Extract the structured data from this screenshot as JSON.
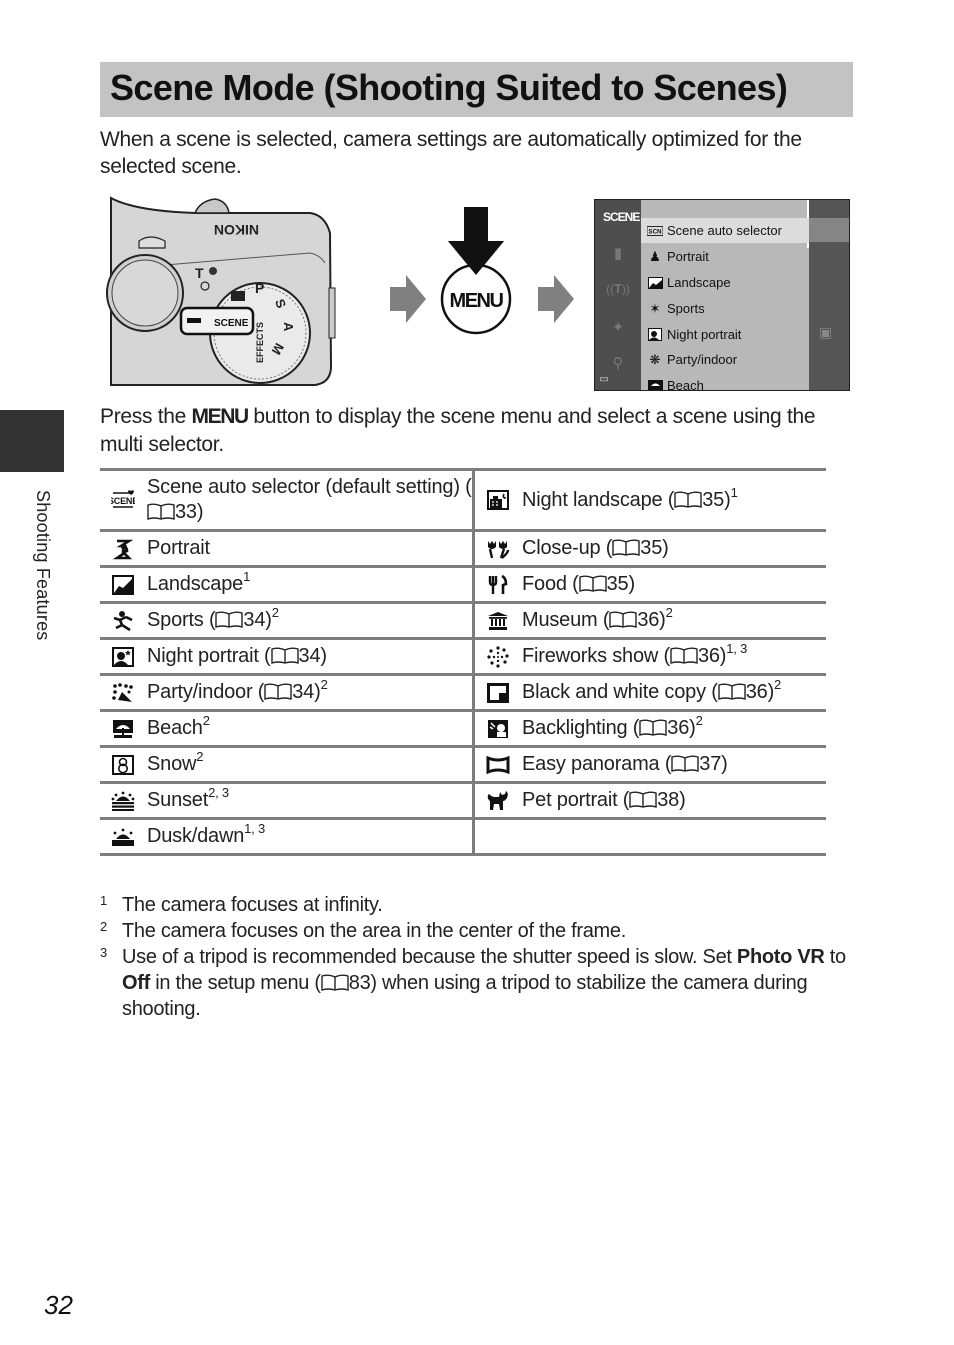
{
  "page": {
    "title": "Scene Mode (Shooting Suited to Scenes)",
    "intro": "When a scene is selected, camera settings are automatically optimized for the selected scene.",
    "side_label": "Shooting Features",
    "page_number": "32"
  },
  "illustration": {
    "camera": {
      "brand": "Nikon",
      "dial_labels": [
        "P",
        "S",
        "A",
        "M",
        "EFFECTS",
        "SCENE"
      ],
      "zoom_label": "T"
    },
    "menu_button_label": "MENU",
    "screen": {
      "left_icon": "SCENE",
      "items": [
        {
          "icon": "scene-auto-icon",
          "label": "Scene auto selector",
          "selected": true
        },
        {
          "icon": "portrait-icon",
          "label": "Portrait"
        },
        {
          "icon": "landscape-icon",
          "label": "Landscape"
        },
        {
          "icon": "sports-icon",
          "label": "Sports"
        },
        {
          "icon": "night-portrait-icon",
          "label": "Night portrait"
        },
        {
          "icon": "party-icon",
          "label": "Party/indoor"
        },
        {
          "icon": "beach-icon",
          "label": "Beach"
        }
      ]
    }
  },
  "instruction": {
    "before": "Press the ",
    "button": "MENU",
    "after": " button to display the scene menu and select a scene using the multi selector."
  },
  "scenes": {
    "left": [
      {
        "icon": "scene-auto-icon",
        "label": "Scene auto selector (default setting) (",
        "ref": "33",
        "close": ")",
        "sup": ""
      },
      {
        "icon": "portrait-icon",
        "label": "Portrait",
        "ref": "",
        "close": "",
        "sup": ""
      },
      {
        "icon": "landscape-icon",
        "label": "Landscape",
        "ref": "",
        "close": "",
        "sup": "1"
      },
      {
        "icon": "sports-icon",
        "label": "Sports (",
        "ref": "34",
        "close": ")",
        "sup": "2"
      },
      {
        "icon": "night-portrait-icon",
        "label": "Night portrait (",
        "ref": "34",
        "close": ")",
        "sup": ""
      },
      {
        "icon": "party-icon",
        "label": "Party/indoor (",
        "ref": "34",
        "close": ")",
        "sup": "2"
      },
      {
        "icon": "beach-icon",
        "label": "Beach",
        "ref": "",
        "close": "",
        "sup": "2"
      },
      {
        "icon": "snow-icon",
        "label": "Snow",
        "ref": "",
        "close": "",
        "sup": "2"
      },
      {
        "icon": "sunset-icon",
        "label": "Sunset",
        "ref": "",
        "close": "",
        "sup": "2, 3"
      },
      {
        "icon": "dusk-dawn-icon",
        "label": "Dusk/dawn",
        "ref": "",
        "close": "",
        "sup": "1, 3"
      }
    ],
    "right": [
      {
        "icon": "night-landscape-icon",
        "label": "Night landscape (",
        "ref": "35",
        "close": ")",
        "sup": "1"
      },
      {
        "icon": "close-up-icon",
        "label": "Close-up (",
        "ref": "35",
        "close": ")",
        "sup": ""
      },
      {
        "icon": "food-icon",
        "label": "Food (",
        "ref": "35",
        "close": ")",
        "sup": ""
      },
      {
        "icon": "museum-icon",
        "label": "Museum (",
        "ref": "36",
        "close": ")",
        "sup": "2"
      },
      {
        "icon": "fireworks-icon",
        "label": "Fireworks show (",
        "ref": "36",
        "close": ")",
        "sup": "1, 3"
      },
      {
        "icon": "bw-copy-icon",
        "label": "Black and white copy (",
        "ref": "36",
        "close": ")",
        "sup": "2"
      },
      {
        "icon": "backlighting-icon",
        "label": "Backlighting (",
        "ref": "36",
        "close": ")",
        "sup": "2"
      },
      {
        "icon": "panorama-icon",
        "label": "Easy panorama (",
        "ref": "37",
        "close": ")",
        "sup": ""
      },
      {
        "icon": "pet-portrait-icon",
        "label": "Pet portrait (",
        "ref": "38",
        "close": ")",
        "sup": ""
      }
    ]
  },
  "notes": [
    {
      "num": "1",
      "text": "The camera focuses at infinity."
    },
    {
      "num": "2",
      "text": "The camera focuses on the area in the center of the frame."
    },
    {
      "num": "3",
      "parts": {
        "a": "Use of a tripod is recommended because the shutter speed is slow. Set ",
        "b": "Photo VR",
        "c": " to ",
        "d": "Off",
        "e": " in the setup menu (",
        "ref": "83",
        "f": ") when using a tripod to stabilize the camera during shooting."
      }
    }
  ]
}
